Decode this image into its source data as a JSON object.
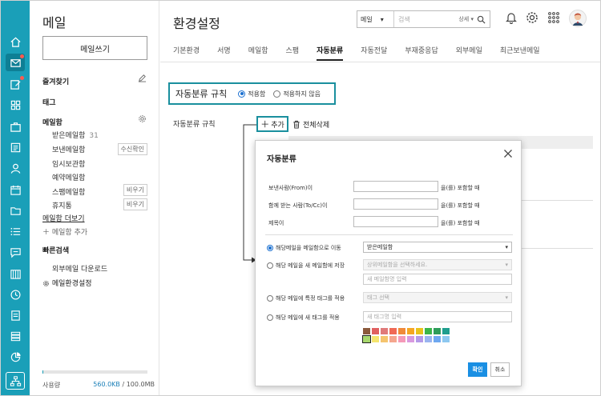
{
  "sidebar": {
    "title": "메일",
    "write_button": "메일쓰기",
    "favorites": "즐겨찾기",
    "tags": "태그",
    "mailbox": "메일함",
    "inbox": "받은메일함",
    "inbox_count": "31",
    "sent": "보낸메일함",
    "sent_btn": "수신확인",
    "temp": "임시보관함",
    "reserved": "예약메일함",
    "spam": "스팸메일함",
    "spam_btn": "비우기",
    "trash": "휴지통",
    "trash_btn": "비우기",
    "more": "메일함 더보기",
    "add_mailbox": "메일함 추가",
    "quick_search": "빠른검색",
    "external_download": "외부메일 다운로드",
    "mail_settings": "메일환경설정",
    "usage_label": "사용량",
    "usage_used": "560.0KB",
    "usage_total": "/ 100.0MB",
    "usage_fraction": 0.01
  },
  "header": {
    "title": "환경설정",
    "search_scope": "메일",
    "search_placeholder": "검색",
    "search_detail": "상세"
  },
  "tabs": [
    "기본환경",
    "서명",
    "메일함",
    "스팸",
    "자동분류",
    "자동전달",
    "부재중응답",
    "외부메일",
    "최근보낸메일"
  ],
  "rule": {
    "title": "자동분류 규칙",
    "apply": "적용함",
    "not_apply": "적용하지 않음"
  },
  "rules_section": {
    "label": "자동분류 규칙",
    "add": "추가",
    "delete_all": "전체삭제"
  },
  "modal": {
    "title": "자동분류",
    "from_label": "보낸사람(From)이",
    "to_label": "함께 받는 사람(To/Cc)이",
    "subject_label": "제목이",
    "suffix": "을(를) 포함할 때",
    "move_label": "해당메일을 메일함으로 이동",
    "move_value": "받은메일함",
    "new_box_label": "해당 메일을 새 메일함에 저장",
    "parent_box_placeholder": "상위메일함을 선택하세요.",
    "new_box_name_placeholder": "새 메일함명 입력",
    "tag_label": "해당 메일에 특정 태그를 적용",
    "tag_select": "태그 선택",
    "new_tag_label": "해당 메일에 새 태그를 적용",
    "new_tag_placeholder": "새 태그명 입력",
    "ok": "확인",
    "cancel": "취소"
  },
  "colors": {
    "accent": "#1a9fb8",
    "highlight_border": "#1a8f9e",
    "ok_button": "#1a8fe3",
    "palette": [
      "#8b5a3c",
      "#e06060",
      "#e07a7a",
      "#f06a55",
      "#f08a3a",
      "#f5a623",
      "#e8c21b",
      "#3bb54a",
      "#2e9d5a",
      "#1f9e8e",
      "#a8d86e",
      "#f5e56e",
      "#f5c46e",
      "#f5a68e",
      "#f59ab8",
      "#d89ae0",
      "#b49ae8",
      "#9ab4f0",
      "#6ea8f0",
      "#8ec8f0"
    ]
  }
}
